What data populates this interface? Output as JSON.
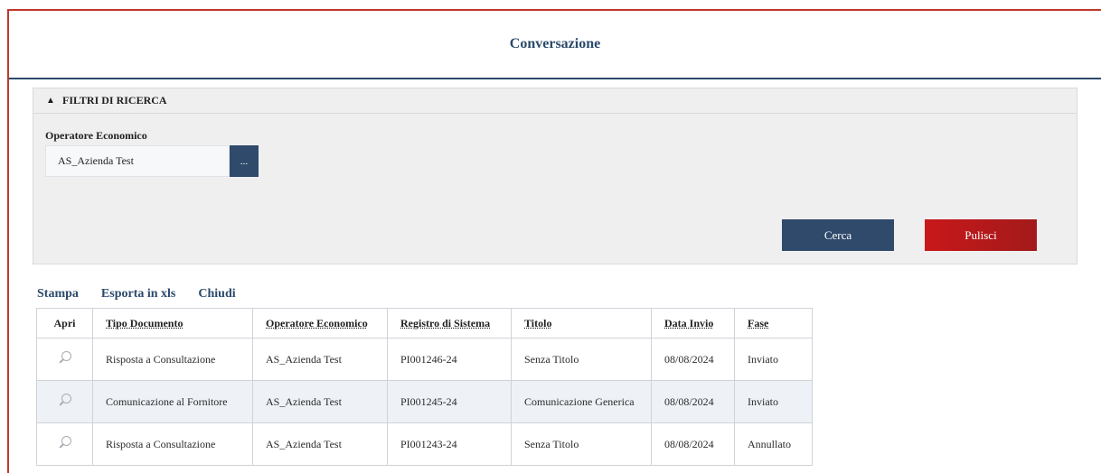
{
  "page": {
    "title": "Conversazione"
  },
  "filters": {
    "section_title": "FILTRI DI RICERCA",
    "operatore_label": "Operatore Economico",
    "operatore_value": "AS_Azienda Test",
    "lookup_button": "...",
    "search_button": "Cerca",
    "clear_button": "Pulisci"
  },
  "actions": {
    "print": "Stampa",
    "export": "Esporta in xls",
    "close": "Chiudi"
  },
  "table": {
    "headers": [
      "Apri",
      "Tipo Documento",
      "Operatore Economico",
      "Registro di Sistema",
      "Titolo",
      "Data Invio",
      "Fase"
    ],
    "rows": [
      [
        "",
        "Risposta a Consultazione",
        "AS_Azienda Test",
        "PI001246-24",
        "Senza Titolo",
        "08/08/2024",
        "Inviato"
      ],
      [
        "",
        "Comunicazione al Fornitore",
        "AS_Azienda Test",
        "PI001245-24",
        "Comunicazione Generica",
        "08/08/2024",
        "Inviato"
      ],
      [
        "",
        "Risposta a Consultazione",
        "AS_Azienda Test",
        "PI001243-24",
        "Senza Titolo",
        "08/08/2024",
        "Annullato"
      ]
    ]
  },
  "colors": {
    "brand_blue": "#2f4a6b",
    "brand_red": "#c8181a",
    "frame_red": "#c0392b"
  }
}
